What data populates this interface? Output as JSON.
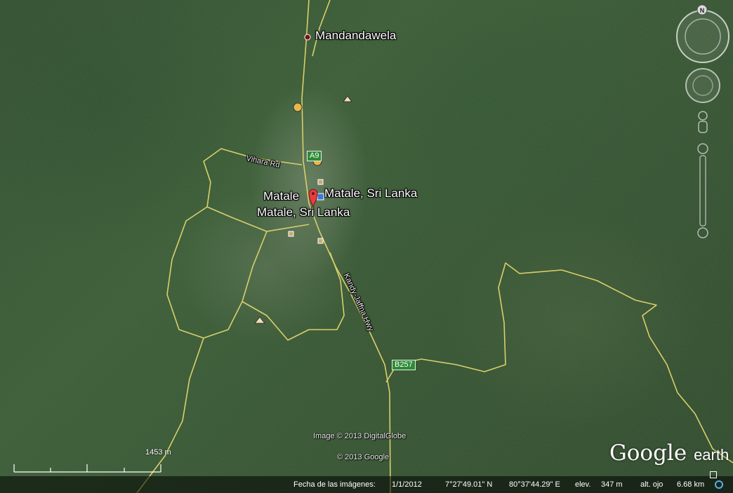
{
  "places": {
    "mandandawela": "Mandandawela",
    "matale_short": "Matale",
    "matale_full_right": "Matale, Sri Lanka",
    "matale_full_below": "Matale, Sri Lanka"
  },
  "roads": {
    "vihara": "Vihara Rd",
    "kandy_jaffna": "Kandy-Jaffna Hwy",
    "a9_shield": "A9",
    "b257_shield": "B257"
  },
  "scale": {
    "label": "1453 m"
  },
  "attribution": {
    "imagery": "Image © 2013 DigitalGlobe",
    "google": "© 2013 Google"
  },
  "logo": {
    "brand": "Google",
    "product": "earth"
  },
  "status_bar": {
    "imagery_date_label": "Fecha de las imágenes:",
    "imagery_date": "1/1/2012",
    "latitude": "7°27'49.01\" N",
    "longitude": "80°37'44.29\" E",
    "elev_label": "elev.",
    "elev_value": "347 m",
    "eye_alt_label": "alt. ojo",
    "eye_alt_value": "6.68 km"
  },
  "nav": {
    "north": "N"
  },
  "colors": {
    "road": "#d9cf6a",
    "pin": "#e04040",
    "shield": "#2e8b36"
  }
}
